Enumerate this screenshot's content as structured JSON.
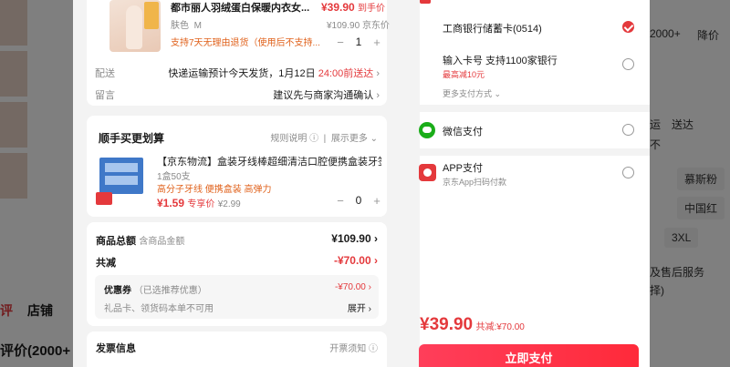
{
  "background": {
    "tabs": [
      "评",
      "店铺"
    ],
    "eval_title": "评价(2000+",
    "right_texts": [
      "2000+",
      "降价",
      "运",
      "送达",
      "不",
      "慕斯粉",
      "中国红",
      "3XL",
      "及售后服务",
      "择)"
    ]
  },
  "product": {
    "title": "都市丽人羽绒蛋白保暖内衣女...",
    "price": "¥39.90",
    "price_suffix": "到手价",
    "color_label": "肤色",
    "size": "M",
    "orig_price": "¥109.90",
    "seller": "京东价",
    "return_policy": "支持7天无理由退货（使用后不支持...",
    "qty": "1"
  },
  "delivery": {
    "label": "配送",
    "text": "快递运输预计今天发货，1月12日",
    "highlight": "24:00前送达"
  },
  "remark": {
    "label": "留言",
    "text": "建议先与商家沟通确认"
  },
  "bundle": {
    "title": "顺手买更划算",
    "rules": "规则说明",
    "more": "展示更多",
    "item_title": "【京东物流】盒装牙线棒超细清洁口腔便携盒装牙签...",
    "spec": "1盒50支",
    "tags": "高分子牙线 便携盒装 高弹力",
    "price": "¥1.59",
    "price_label": "专享价",
    "orig_price": "¥2.99",
    "qty": "0"
  },
  "summary": {
    "total_label": "商品总额",
    "total_sub": "含商品金额",
    "total_value": "¥109.90",
    "discount_label": "共减",
    "discount_value": "-¥70.00",
    "coupon_label": "优惠券",
    "coupon_sub": "（已选推荐优惠）",
    "coupon_value": "-¥70.00",
    "giftcard_label": "礼品卡、领货码本单不可用",
    "giftcard_action": "展开"
  },
  "invoice": {
    "title": "发票信息",
    "notice": "开票须知"
  },
  "payment": {
    "bank": "工商银行储蓄卡(0514)",
    "card_input": "输入卡号 支持1100家银行",
    "card_promo": "最高减10元",
    "more_methods": "更多支付方式",
    "wechat": "微信支付",
    "app": "APP支付",
    "app_sub": "京东App扫码付款",
    "final_price": "¥39.90",
    "final_discount": "共减:¥70.00",
    "pay_button": "立即支付"
  }
}
